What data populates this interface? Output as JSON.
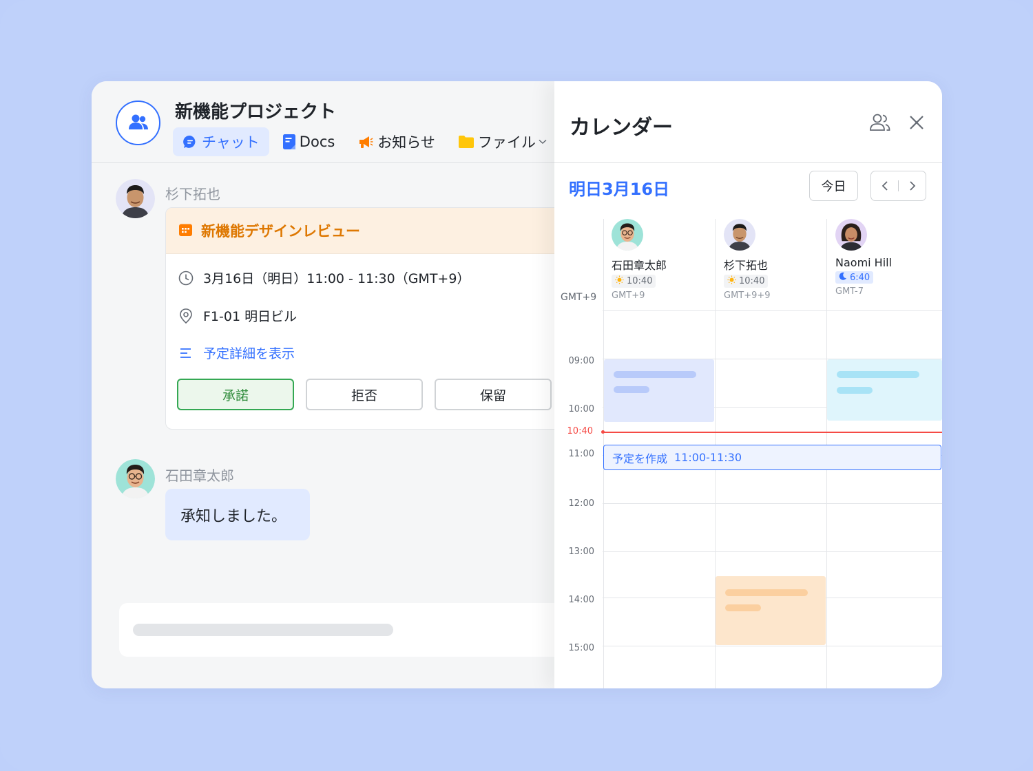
{
  "chat": {
    "group_title": "新機能プロジェクト",
    "tabs": [
      {
        "label": "チャット",
        "icon": "chat-bubble-icon"
      },
      {
        "label": "Docs",
        "icon": "docs-icon"
      },
      {
        "label": "お知らせ",
        "icon": "megaphone-icon"
      },
      {
        "label": "ファイル",
        "icon": "folder-icon"
      }
    ],
    "messages": [
      {
        "sender": "杉下拓也",
        "event": {
          "title": "新機能デザインレビュー",
          "time": "3月16日（明日）11:00 - 11:30（GMT+9）",
          "location": "F1-01 明日ビル",
          "details_link": "予定詳細を表示",
          "accept": "承諾",
          "decline": "拒否",
          "maybe": "保留"
        }
      },
      {
        "sender": "石田章太郎",
        "text": "承知しました。"
      }
    ]
  },
  "calendar": {
    "title": "カレンダー",
    "date_label": "明日3月16日",
    "today_button": "今日",
    "local_tz": "GMT+9",
    "people": [
      {
        "name": "石田章太郎",
        "local_time": "10:40",
        "time_icon": "sun-icon",
        "tz": "GMT+9"
      },
      {
        "name": "杉下拓也",
        "local_time": "10:40",
        "time_icon": "sun-icon",
        "tz": "GMT+9+9"
      },
      {
        "name": "Naomi Hill",
        "local_time": "6:40",
        "time_icon": "moon-icon",
        "tz": "GMT-7"
      }
    ],
    "hours": [
      "09:00",
      "10:00",
      "11:00",
      "12:00",
      "13:00",
      "14:00",
      "15:00"
    ],
    "now": "10:40",
    "new_event": {
      "label": "予定を作成",
      "time": "11:00-11:30"
    },
    "colors": {
      "accent": "#3370ff",
      "now_line": "#f54a45",
      "busy_blue": "#e1e8fd",
      "busy_cyan": "#dff5fc",
      "busy_orange": "#fde6cc"
    }
  }
}
